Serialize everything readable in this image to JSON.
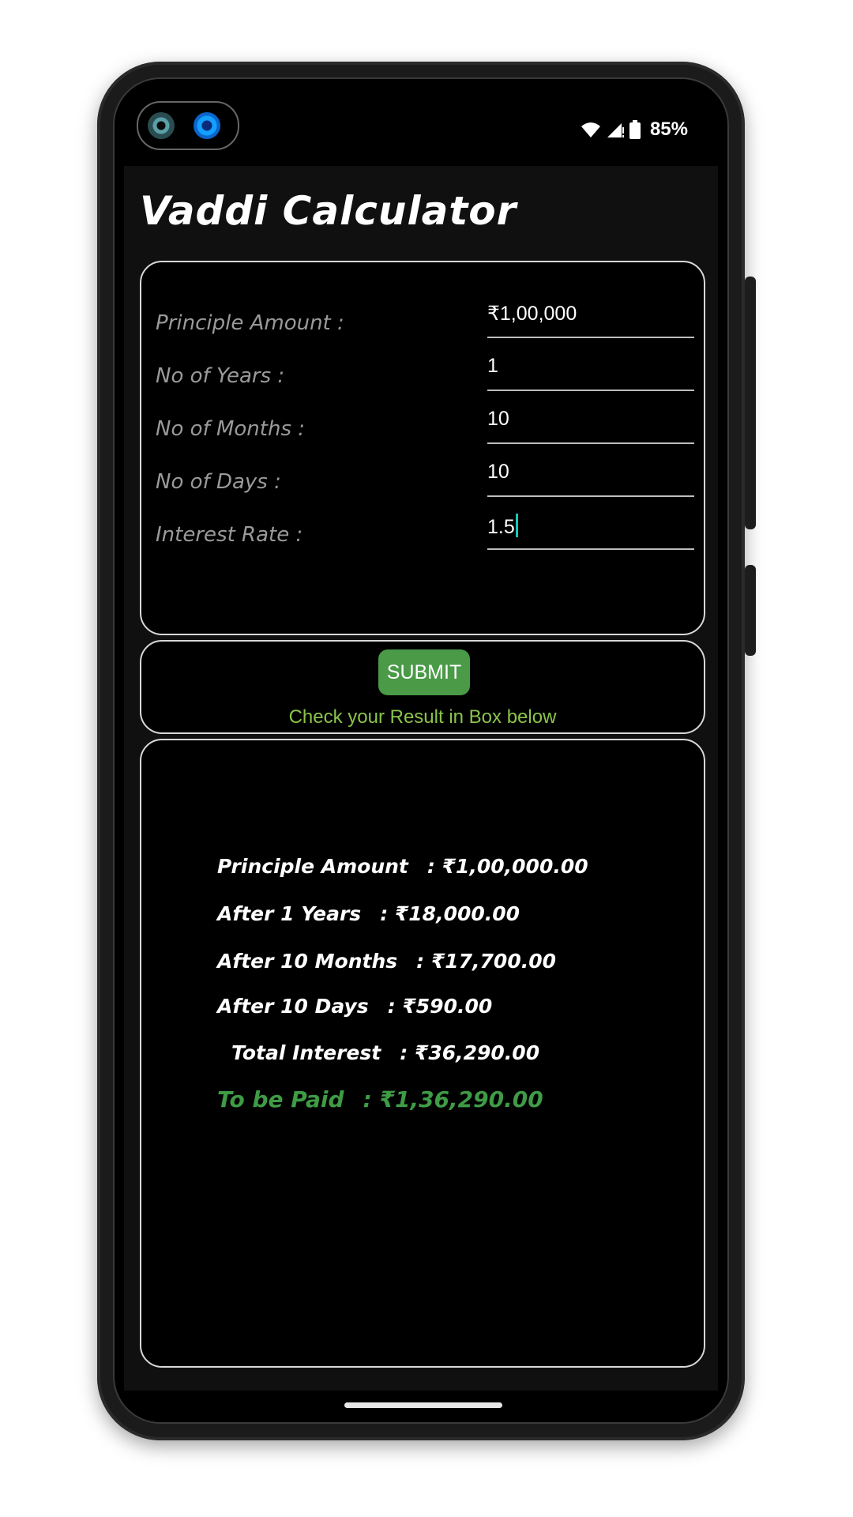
{
  "status_bar": {
    "battery": "85%",
    "icons": [
      "wifi-icon",
      "signal-icon",
      "battery-icon"
    ]
  },
  "app": {
    "title": "Vaddi Calculator",
    "fields": [
      {
        "label": "Principle Amount :",
        "value": "₹1,00,000"
      },
      {
        "label": "No of Years :",
        "value": "1"
      },
      {
        "label": "No of Months :",
        "value": "10"
      },
      {
        "label": "No of Days :",
        "value": "10"
      },
      {
        "label": "Interest Rate :",
        "value": "1.5"
      }
    ],
    "submit_label": "SUBMIT",
    "hint": "Check your Result in Box below",
    "results": [
      {
        "label": "Principle Amount",
        "value": ": ₹1,00,000.00"
      },
      {
        "label": "After 1 Years",
        "value": ": ₹18,000.00"
      },
      {
        "label": "After 10  Months",
        "value": ": ₹17,700.00"
      },
      {
        "label": "After 10  Days",
        "value": ": ₹590.00"
      },
      {
        "label": "Total Interest",
        "value": ": ₹36,290.00"
      },
      {
        "label": "To be Paid",
        "value": ": ₹1,36,290.00"
      }
    ]
  },
  "colors": {
    "accent_green": "#4a9a47",
    "hint_green": "#8bc34a",
    "caret": "#16c8b6",
    "background": "#000000"
  }
}
